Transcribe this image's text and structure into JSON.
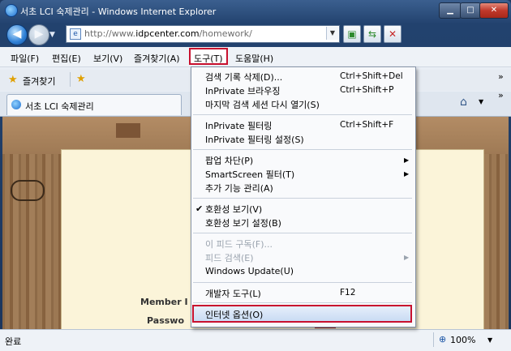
{
  "window": {
    "title": "서초 LCI 숙제관리 - Windows Internet Explorer",
    "controls": {
      "minimize": "▁",
      "maximize": "□",
      "close": "✕"
    }
  },
  "address": {
    "url_prefix": "http://www.",
    "url_domain": "idpcenter.com",
    "url_path": "/homework/"
  },
  "menubar": {
    "items": [
      "파일(F)",
      "편집(E)",
      "보기(V)",
      "즐겨찾기(A)",
      "도구(T)",
      "도움말(H)"
    ]
  },
  "favorites": {
    "label": "즐겨찾기"
  },
  "tab": {
    "label": "서초 LCI 숙제관리"
  },
  "content": {
    "member_id_label": "Member I",
    "password_label": "Passwo"
  },
  "statusbar": {
    "status": "완료",
    "zoom": "100%"
  },
  "tools_menu": {
    "group1": [
      {
        "label": "검색 기록 삭제(D)...",
        "shortcut": "Ctrl+Shift+Del"
      },
      {
        "label": "InPrivate 브라우징",
        "shortcut": "Ctrl+Shift+P"
      },
      {
        "label": "마지막 검색 세션 다시 열기(S)",
        "shortcut": ""
      }
    ],
    "group2": [
      {
        "label": "InPrivate 필터링",
        "shortcut": "Ctrl+Shift+F"
      },
      {
        "label": "InPrivate 필터링 설정(S)",
        "shortcut": ""
      }
    ],
    "group3": [
      {
        "label": "팝업 차단(P)"
      },
      {
        "label": "SmartScreen 필터(T)"
      },
      {
        "label": "추가 기능 관리(A)"
      }
    ],
    "group4": [
      {
        "label": "호환성 보기(V)"
      },
      {
        "label": "호환성 보기 설정(B)"
      }
    ],
    "group5": [
      {
        "label": "이 피드 구독(F)..."
      },
      {
        "label": "피드 검색(E)"
      },
      {
        "label": "Windows Update(U)"
      }
    ],
    "group6": [
      {
        "label": "개발자 도구(L)",
        "shortcut": "F12"
      }
    ],
    "group7": [
      {
        "label": "인터넷 옵션(O)"
      }
    ]
  }
}
